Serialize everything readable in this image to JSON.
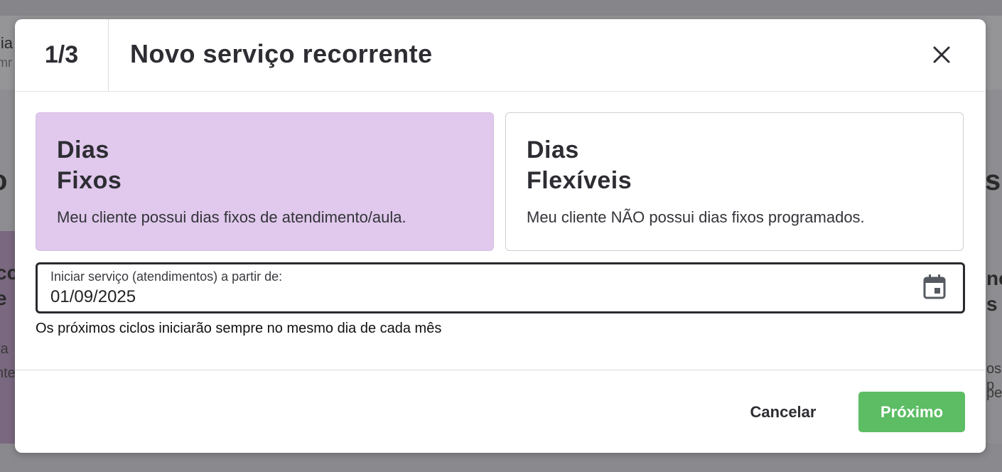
{
  "background": {
    "header_line1": "lia",
    "header_line2": "mr",
    "left_heading": "o",
    "right_heading": "s",
    "left_card_line1": "cc",
    "left_card_line2": "e",
    "left_card_line3": "ra",
    "left_card_line4": "nte",
    "right_card_line1": "nc",
    "right_card_line2": "s",
    "right_card_line3": "os p",
    "right_card_line4": "pe"
  },
  "modal": {
    "step": "1/3",
    "title": "Novo serviço recorrente",
    "close_icon": "close-icon",
    "options": [
      {
        "title_line1": "Dias",
        "title_line2": "Fixos",
        "description": "Meu cliente possui dias fixos de atendimento/aula.",
        "selected": true
      },
      {
        "title_line1": "Dias",
        "title_line2": "Flexíveis",
        "description": "Meu cliente NÃO possui dias fixos programados.",
        "selected": false
      }
    ],
    "start_date": {
      "label": "Iniciar serviço (atendimentos) a partir de:",
      "value": "01/09/2025",
      "icon": "calendar-icon"
    },
    "helper_text": "Os próximos ciclos iniciarão sempre no mesmo dia de cada mês",
    "footer": {
      "cancel_label": "Cancelar",
      "next_label": "Próximo"
    }
  },
  "colors": {
    "selected_card": "#e0c9ec",
    "primary_button": "#5cbd64",
    "overlay": "#8e8e92"
  }
}
